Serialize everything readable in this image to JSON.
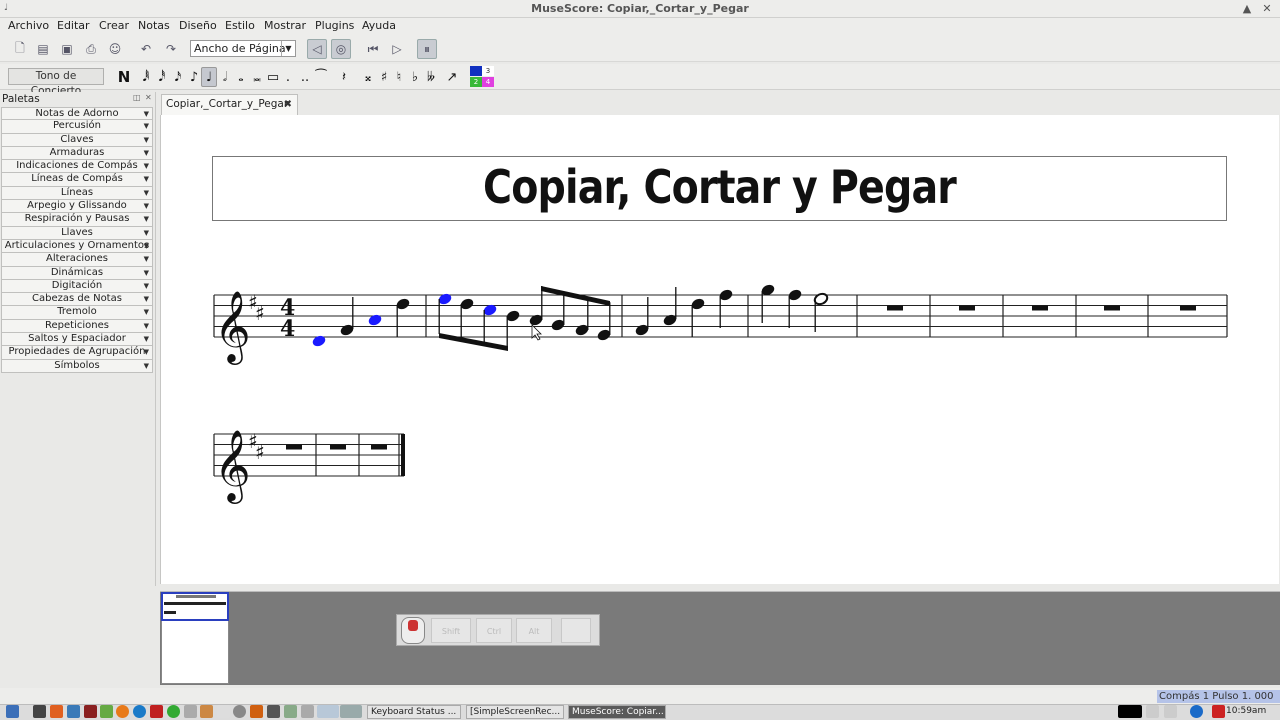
{
  "window": {
    "title": "MuseScore: Copiar,_Cortar_y_Pegar",
    "minimize": "▲",
    "close": "✕"
  },
  "menu": [
    "Archivo",
    "Editar",
    "Crear",
    "Notas",
    "Diseño",
    "Estilo",
    "Mostrar",
    "Plugins",
    "Ayuda"
  ],
  "toolbar": {
    "zoom_value": "Ancho de Página"
  },
  "note_input": {
    "concert_pitch_label": "Tono de Concierto",
    "note_mode_glyph": "N",
    "voices": [
      "1",
      "2",
      "3",
      "4"
    ]
  },
  "palettes": {
    "title": "Paletas",
    "items": [
      "Notas de Adorno",
      "Percusión",
      "Claves",
      "Armaduras",
      "Indicaciones de Compás",
      "Líneas de Compás",
      "Líneas",
      "Arpegio y Glissando",
      "Respiración y Pausas",
      "Llaves",
      "Articulaciones y Ornamentos",
      "Alteraciones",
      "Dinámicas",
      "Digitación",
      "Cabezas de Notas",
      "Tremolo",
      "Repeticiones",
      "Saltos y Espaciador",
      "Propiedades de Agrupación",
      "Símbolos"
    ]
  },
  "tab": {
    "label": "Copiar,_Cortar_y_Pegar",
    "close": "✖"
  },
  "score": {
    "title": "Copiar, Cortar y Pegar",
    "time_signature": {
      "top": "4",
      "bottom": "4"
    },
    "selected_color": "#1a1aff"
  },
  "keystatus": {
    "keys": [
      "Shift",
      "Ctrl",
      "Alt"
    ]
  },
  "status": {
    "measure_info": "Compás   1 Pulso   1. 000"
  },
  "taskbar": {
    "tasks": [
      "Keyboard Status ...",
      "[SimpleScreenRec...",
      "MuseScore: Copiar..."
    ],
    "clock": "10:59am"
  }
}
